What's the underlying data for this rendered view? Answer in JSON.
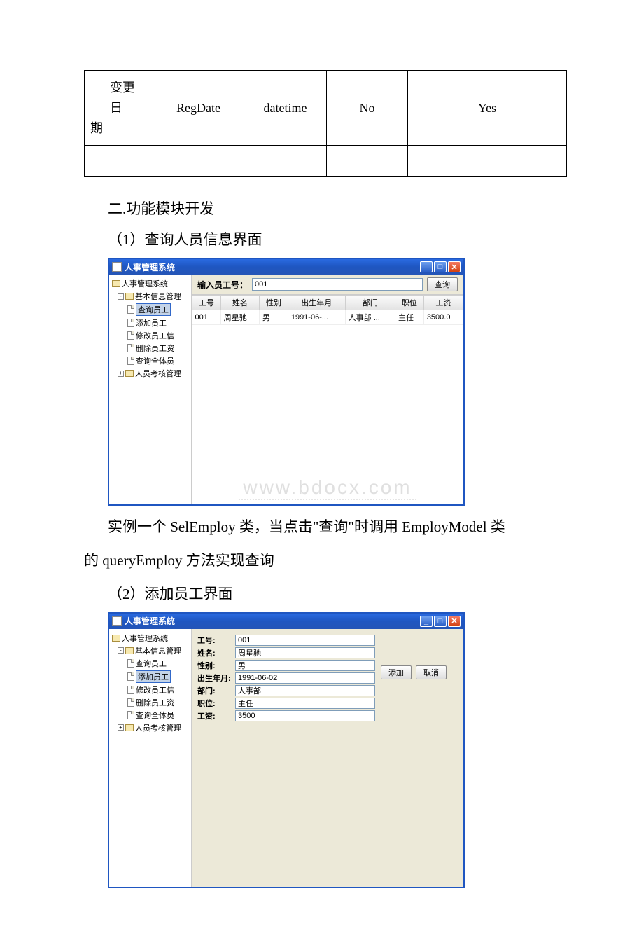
{
  "table": {
    "row1": {
      "c1_line1": "变更日",
      "c1_line2": "期",
      "c2": "RegDate",
      "c3": "datetime",
      "c4": "No",
      "c5": "Yes"
    }
  },
  "headings": {
    "h2": "二.功能模块开发",
    "s1": "（1）查询人员信息界面",
    "s2": "（2）添加员工界面"
  },
  "paragraph1_a": "实例一个 SelEmploy 类，当点击\"查询\"时调用 EmployModel 类",
  "paragraph1_b": "的 queryEmploy 方法实现查询",
  "app": {
    "title": "人事管理系统",
    "tree": {
      "root": "人事管理系统",
      "basic": "基本信息管理",
      "query": "查询员工",
      "add": "添加员工",
      "modify": "修改员工信",
      "delete": "删除员工资",
      "queryAll": "查询全体员",
      "assess": "人员考核管理"
    },
    "search": {
      "label": "输入员工号：",
      "value": "001",
      "button": "查询"
    },
    "grid": {
      "headers": [
        "工号",
        "姓名",
        "性别",
        "出生年月",
        "部门",
        "职位",
        "工资"
      ],
      "row": [
        "001",
        "周星驰",
        "男",
        "1991-06-...",
        "人事部    ...",
        "主任",
        "3500.0"
      ]
    },
    "form": {
      "labels": {
        "id": "工号:",
        "name": "姓名:",
        "gender": "性别:",
        "birth": "出生年月:",
        "dept": "部门:",
        "pos": "职位:",
        "salary": "工资:"
      },
      "values": {
        "id": "001",
        "name": "周星驰",
        "gender": "男",
        "birth": "1991-06-02",
        "dept": "人事部",
        "pos": "主任",
        "salary": "3500"
      },
      "buttons": {
        "add": "添加",
        "cancel": "取消"
      }
    }
  },
  "watermark": "www.bdocx.com"
}
